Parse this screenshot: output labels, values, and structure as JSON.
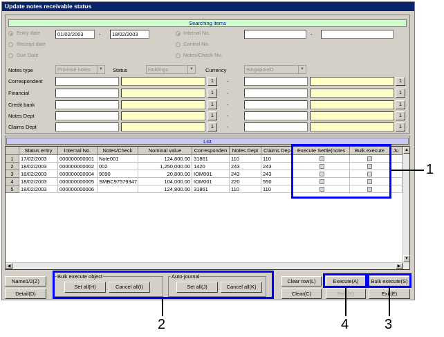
{
  "window": {
    "title": "Update notes receivable status"
  },
  "search": {
    "header": "Searching items",
    "entry_date_label": "Entry date",
    "receipt_date_label": "Receipt date",
    "due_date_label": "Due Date",
    "date_from": "01/02/2003",
    "date_to": "18/02/2003",
    "dash": "-",
    "internal_no_label": "Internal No.",
    "control_no_label": "Control No.",
    "notes_check_no_label": "Notes/Check No.",
    "notes_type_label": "Notes type",
    "notes_type_value": "Promise notes",
    "status_label": "Status",
    "status_value": "Holdings",
    "currency_label": "Currency",
    "currency_value": "SingaporeD",
    "lookup_button_label": "1",
    "rows": [
      {
        "label": "Correspondent"
      },
      {
        "label": "Financial"
      },
      {
        "label": "Credit bank"
      },
      {
        "label": "Notes Dept"
      },
      {
        "label": "Claims Dept"
      }
    ]
  },
  "list": {
    "header": "List",
    "columns": [
      "Status entry",
      "Internal No.",
      "Notes/Check",
      "Nominal value",
      "Corresponden",
      "Notes Dept",
      "Claims Dep",
      "Execute Settle(notes",
      "Bulk execute",
      "Ju"
    ],
    "rows": [
      {
        "num": "1",
        "date": "17/02/2003",
        "internal": "000000000001",
        "notes": "Note001",
        "nominal": "124,800.00",
        "corr": "31861",
        "notes_dept": "110",
        "claims": "110"
      },
      {
        "num": "2",
        "date": "18/02/2003",
        "internal": "000000000002",
        "notes": "002",
        "nominal": "1,250,000.00",
        "corr": "1420",
        "notes_dept": "243",
        "claims": "243"
      },
      {
        "num": "3",
        "date": "18/02/2003",
        "internal": "000000000004",
        "notes": "9090",
        "nominal": "20,800.00",
        "corr": "IOM001",
        "notes_dept": "243",
        "claims": "243"
      },
      {
        "num": "4",
        "date": "18/02/2003",
        "internal": "000000000005",
        "notes": "SMBC97579347",
        "nominal": "104,000.00",
        "corr": "IOM001",
        "notes_dept": "220",
        "claims": "550"
      },
      {
        "num": "5",
        "date": "18/02/2003",
        "internal": "000000000006",
        "notes": "",
        "nominal": "124,800.00",
        "corr": "31861",
        "notes_dept": "110",
        "claims": "110"
      }
    ]
  },
  "bottom": {
    "name_button": "Name1/2(Z)",
    "detail_button": "Detail(D)",
    "bulk_group_label": "Bulk execute object",
    "bulk_set_all": "Set all(H)",
    "bulk_cancel_all": "Cancel all(I)",
    "auto_group_label": "Auto-journal",
    "auto_set_all": "Set all(J)",
    "auto_cancel_all": "Cancel all(K)",
    "clear_row": "Clear row(L)",
    "clear": "Clear(C)",
    "execute": "Execute(A)",
    "refresh": "Refr(X)",
    "bulk_execute": "Bulk execute(S)",
    "exit": "Exit(E)"
  },
  "callouts": {
    "c1": "1",
    "c2": "2",
    "c3": "3",
    "c4": "4"
  },
  "colors": {
    "title_bg": "#0a246a",
    "section_header_bg": "#ccffcc",
    "callout": "#0000ff",
    "lookup_field": "#ffffc8"
  }
}
